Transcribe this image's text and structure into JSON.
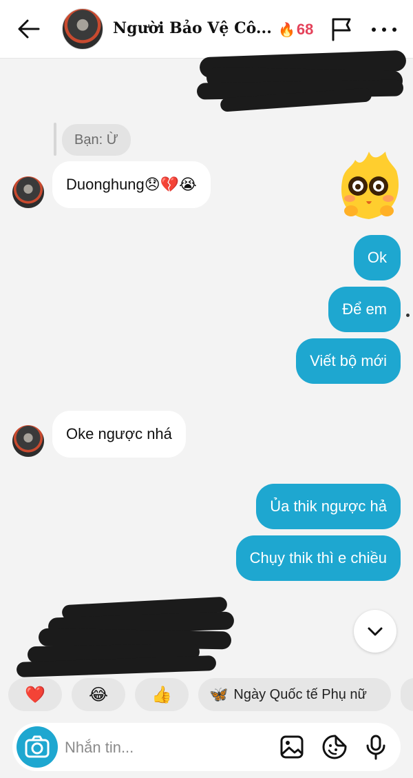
{
  "header": {
    "contact_name": "Người Bảo Vệ Cô...",
    "streak_emoji": "🔥",
    "streak_count": "68"
  },
  "messages": {
    "reply_quote": "Bạn: Ừ",
    "in_1": "Duonghung😞💔😭",
    "out_1": "Ok",
    "out_2": "Để em",
    "out_3": "Viết bộ mới",
    "in_2": "Oke ngược nhá",
    "out_4": "Ủa thik ngược hả",
    "out_5": "Chụy thik thì e chiều"
  },
  "quick_replies": {
    "heart": "❤️",
    "laugh": "😂",
    "thumbs": "👍",
    "womens_day_emoji": "🦋",
    "womens_day": "Ngày Quốc tế Phụ nữ"
  },
  "composer": {
    "placeholder": "Nhắn tin..."
  },
  "colors": {
    "accent": "#1ea7d0",
    "streak": "#e4425a",
    "background": "#f3f3f3"
  }
}
